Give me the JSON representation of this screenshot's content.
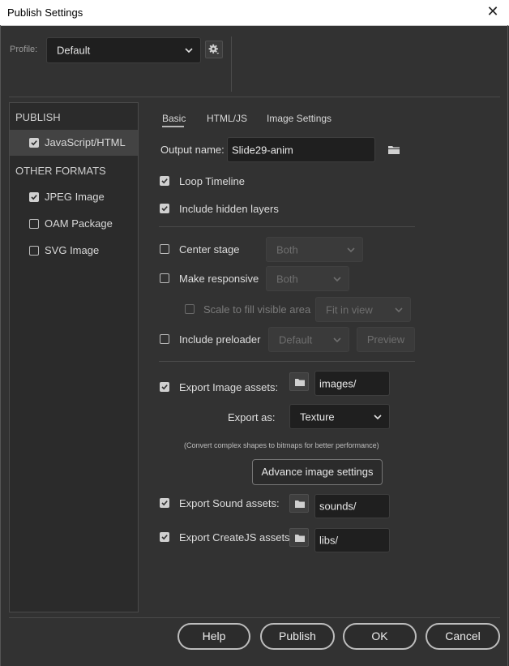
{
  "window": {
    "title": "Publish Settings",
    "close_glyph": "✕"
  },
  "profile": {
    "label": "Profile:",
    "value": "Default"
  },
  "sidebar": {
    "publish_heading": "PUBLISH",
    "other_heading": "OTHER FORMATS",
    "items": [
      {
        "label": "JavaScript/HTML",
        "checked": true,
        "selected": true
      },
      {
        "label": "JPEG Image",
        "checked": true,
        "selected": false
      },
      {
        "label": "OAM Package",
        "checked": false,
        "selected": false
      },
      {
        "label": "SVG Image",
        "checked": false,
        "selected": false
      }
    ]
  },
  "tabs": [
    {
      "label": "Basic",
      "active": true
    },
    {
      "label": "HTML/JS",
      "active": false
    },
    {
      "label": "Image Settings",
      "active": false
    }
  ],
  "basic": {
    "output_name_label": "Output name:",
    "output_name_value": "Slide29-anim",
    "loop_timeline": {
      "label": "Loop Timeline",
      "checked": true
    },
    "include_hidden": {
      "label": "Include hidden layers",
      "checked": true
    },
    "center_stage": {
      "label": "Center stage",
      "checked": false,
      "value": "Both"
    },
    "make_responsive": {
      "label": "Make responsive",
      "checked": false,
      "value": "Both"
    },
    "scale_fill": {
      "label": "Scale to fill visible area",
      "checked": false,
      "value": "Fit in view"
    },
    "include_preloader": {
      "label": "Include preloader",
      "checked": false,
      "value": "Default",
      "preview_label": "Preview"
    },
    "export_image": {
      "label": "Export Image assets:",
      "checked": true,
      "path": "images/"
    },
    "export_as": {
      "label": "Export as:",
      "value": "Texture"
    },
    "note": "(Convert complex shapes to bitmaps for better performance)",
    "advance_label": "Advance image settings",
    "export_sound": {
      "label": "Export Sound assets:",
      "checked": true,
      "path": "sounds/"
    },
    "export_createjs": {
      "label": "Export CreateJS assets:",
      "checked": true,
      "path": "libs/"
    }
  },
  "footer": {
    "help": "Help",
    "publish": "Publish",
    "ok": "OK",
    "cancel": "Cancel"
  },
  "icons": {
    "gear": "gear-icon",
    "folder": "folder-icon",
    "checkmark": "check-icon",
    "chevron": "chevron-down-icon",
    "close": "close-icon"
  },
  "colors": {
    "background": "#323232",
    "sidebar": "#2b2b2b",
    "selected": "#434343",
    "field": "#1f1f1f"
  }
}
